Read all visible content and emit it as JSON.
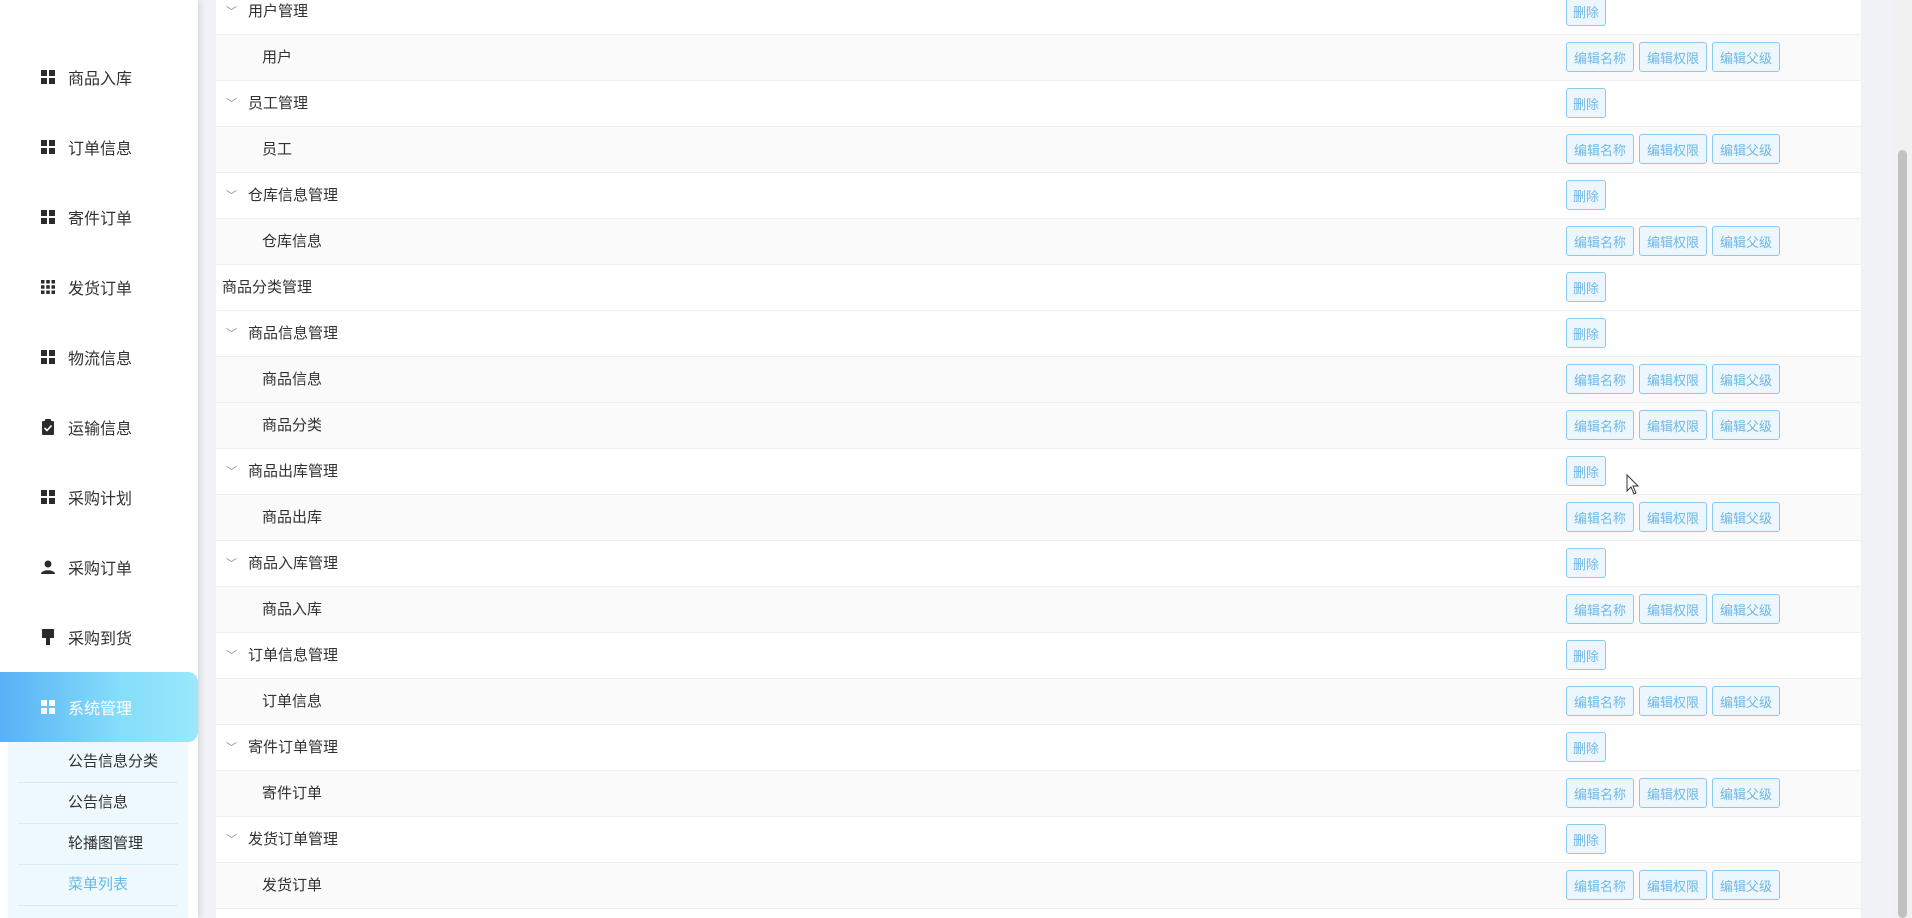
{
  "sidebar": {
    "items": [
      {
        "label": "商品入库",
        "icon": "grid-icon"
      },
      {
        "label": "订单信息",
        "icon": "grid-icon"
      },
      {
        "label": "寄件订单",
        "icon": "grid-icon"
      },
      {
        "label": "发货订单",
        "icon": "apps-icon"
      },
      {
        "label": "物流信息",
        "icon": "grid-icon"
      },
      {
        "label": "运输信息",
        "icon": "clipboard-check-icon"
      },
      {
        "label": "采购计划",
        "icon": "grid-icon"
      },
      {
        "label": "采购订单",
        "icon": "user-icon"
      },
      {
        "label": "采购到货",
        "icon": "brush-icon"
      },
      {
        "label": "系统管理",
        "icon": "grid-icon",
        "active": true
      }
    ],
    "submenu": [
      {
        "label": "公告信息分类"
      },
      {
        "label": "公告信息"
      },
      {
        "label": "轮播图管理"
      },
      {
        "label": "菜单列表",
        "active": true
      }
    ]
  },
  "actions": {
    "delete": "删除",
    "edit_name": "编辑名称",
    "edit_permission": "编辑权限",
    "edit_parent": "编辑父级"
  },
  "rows": [
    {
      "name": "用户管理",
      "type": "parent"
    },
    {
      "name": "用户",
      "type": "child"
    },
    {
      "name": "员工管理",
      "type": "parent"
    },
    {
      "name": "员工",
      "type": "child"
    },
    {
      "name": "仓库信息管理",
      "type": "parent"
    },
    {
      "name": "仓库信息",
      "type": "child"
    },
    {
      "name": "商品分类管理",
      "type": "leaf-parent"
    },
    {
      "name": "商品信息管理",
      "type": "parent"
    },
    {
      "name": "商品信息",
      "type": "child"
    },
    {
      "name": "商品分类",
      "type": "child"
    },
    {
      "name": "商品出库管理",
      "type": "parent"
    },
    {
      "name": "商品出库",
      "type": "child"
    },
    {
      "name": "商品入库管理",
      "type": "parent"
    },
    {
      "name": "商品入库",
      "type": "child"
    },
    {
      "name": "订单信息管理",
      "type": "parent"
    },
    {
      "name": "订单信息",
      "type": "child"
    },
    {
      "name": "寄件订单管理",
      "type": "parent"
    },
    {
      "name": "寄件订单",
      "type": "child"
    },
    {
      "name": "发货订单管理",
      "type": "parent"
    },
    {
      "name": "发货订单",
      "type": "child"
    }
  ],
  "colors": {
    "accent": "#6fb8e6",
    "active_gradient_start": "#58b1f6",
    "active_gradient_end": "#9ae8fb"
  }
}
